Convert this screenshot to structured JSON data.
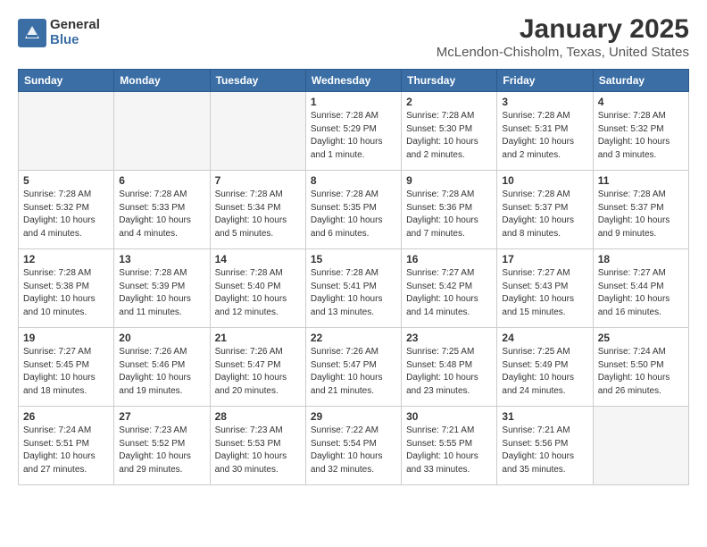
{
  "header": {
    "logo_general": "General",
    "logo_blue": "Blue",
    "month_title": "January 2025",
    "location": "McLendon-Chisholm, Texas, United States"
  },
  "days_of_week": [
    "Sunday",
    "Monday",
    "Tuesday",
    "Wednesday",
    "Thursday",
    "Friday",
    "Saturday"
  ],
  "weeks": [
    [
      {
        "num": "",
        "empty": true
      },
      {
        "num": "",
        "empty": true
      },
      {
        "num": "",
        "empty": true
      },
      {
        "num": "1",
        "sunrise": "7:28 AM",
        "sunset": "5:29 PM",
        "daylight": "10 hours and 1 minute."
      },
      {
        "num": "2",
        "sunrise": "7:28 AM",
        "sunset": "5:30 PM",
        "daylight": "10 hours and 2 minutes."
      },
      {
        "num": "3",
        "sunrise": "7:28 AM",
        "sunset": "5:31 PM",
        "daylight": "10 hours and 2 minutes."
      },
      {
        "num": "4",
        "sunrise": "7:28 AM",
        "sunset": "5:32 PM",
        "daylight": "10 hours and 3 minutes."
      }
    ],
    [
      {
        "num": "5",
        "sunrise": "7:28 AM",
        "sunset": "5:32 PM",
        "daylight": "10 hours and 4 minutes."
      },
      {
        "num": "6",
        "sunrise": "7:28 AM",
        "sunset": "5:33 PM",
        "daylight": "10 hours and 4 minutes."
      },
      {
        "num": "7",
        "sunrise": "7:28 AM",
        "sunset": "5:34 PM",
        "daylight": "10 hours and 5 minutes."
      },
      {
        "num": "8",
        "sunrise": "7:28 AM",
        "sunset": "5:35 PM",
        "daylight": "10 hours and 6 minutes."
      },
      {
        "num": "9",
        "sunrise": "7:28 AM",
        "sunset": "5:36 PM",
        "daylight": "10 hours and 7 minutes."
      },
      {
        "num": "10",
        "sunrise": "7:28 AM",
        "sunset": "5:37 PM",
        "daylight": "10 hours and 8 minutes."
      },
      {
        "num": "11",
        "sunrise": "7:28 AM",
        "sunset": "5:37 PM",
        "daylight": "10 hours and 9 minutes."
      }
    ],
    [
      {
        "num": "12",
        "sunrise": "7:28 AM",
        "sunset": "5:38 PM",
        "daylight": "10 hours and 10 minutes."
      },
      {
        "num": "13",
        "sunrise": "7:28 AM",
        "sunset": "5:39 PM",
        "daylight": "10 hours and 11 minutes."
      },
      {
        "num": "14",
        "sunrise": "7:28 AM",
        "sunset": "5:40 PM",
        "daylight": "10 hours and 12 minutes."
      },
      {
        "num": "15",
        "sunrise": "7:28 AM",
        "sunset": "5:41 PM",
        "daylight": "10 hours and 13 minutes."
      },
      {
        "num": "16",
        "sunrise": "7:27 AM",
        "sunset": "5:42 PM",
        "daylight": "10 hours and 14 minutes."
      },
      {
        "num": "17",
        "sunrise": "7:27 AM",
        "sunset": "5:43 PM",
        "daylight": "10 hours and 15 minutes."
      },
      {
        "num": "18",
        "sunrise": "7:27 AM",
        "sunset": "5:44 PM",
        "daylight": "10 hours and 16 minutes."
      }
    ],
    [
      {
        "num": "19",
        "sunrise": "7:27 AM",
        "sunset": "5:45 PM",
        "daylight": "10 hours and 18 minutes."
      },
      {
        "num": "20",
        "sunrise": "7:26 AM",
        "sunset": "5:46 PM",
        "daylight": "10 hours and 19 minutes."
      },
      {
        "num": "21",
        "sunrise": "7:26 AM",
        "sunset": "5:47 PM",
        "daylight": "10 hours and 20 minutes."
      },
      {
        "num": "22",
        "sunrise": "7:26 AM",
        "sunset": "5:47 PM",
        "daylight": "10 hours and 21 minutes."
      },
      {
        "num": "23",
        "sunrise": "7:25 AM",
        "sunset": "5:48 PM",
        "daylight": "10 hours and 23 minutes."
      },
      {
        "num": "24",
        "sunrise": "7:25 AM",
        "sunset": "5:49 PM",
        "daylight": "10 hours and 24 minutes."
      },
      {
        "num": "25",
        "sunrise": "7:24 AM",
        "sunset": "5:50 PM",
        "daylight": "10 hours and 26 minutes."
      }
    ],
    [
      {
        "num": "26",
        "sunrise": "7:24 AM",
        "sunset": "5:51 PM",
        "daylight": "10 hours and 27 minutes."
      },
      {
        "num": "27",
        "sunrise": "7:23 AM",
        "sunset": "5:52 PM",
        "daylight": "10 hours and 29 minutes."
      },
      {
        "num": "28",
        "sunrise": "7:23 AM",
        "sunset": "5:53 PM",
        "daylight": "10 hours and 30 minutes."
      },
      {
        "num": "29",
        "sunrise": "7:22 AM",
        "sunset": "5:54 PM",
        "daylight": "10 hours and 32 minutes."
      },
      {
        "num": "30",
        "sunrise": "7:21 AM",
        "sunset": "5:55 PM",
        "daylight": "10 hours and 33 minutes."
      },
      {
        "num": "31",
        "sunrise": "7:21 AM",
        "sunset": "5:56 PM",
        "daylight": "10 hours and 35 minutes."
      },
      {
        "num": "",
        "empty": true
      }
    ]
  ],
  "labels": {
    "sunrise": "Sunrise:",
    "sunset": "Sunset:",
    "daylight": "Daylight:"
  }
}
